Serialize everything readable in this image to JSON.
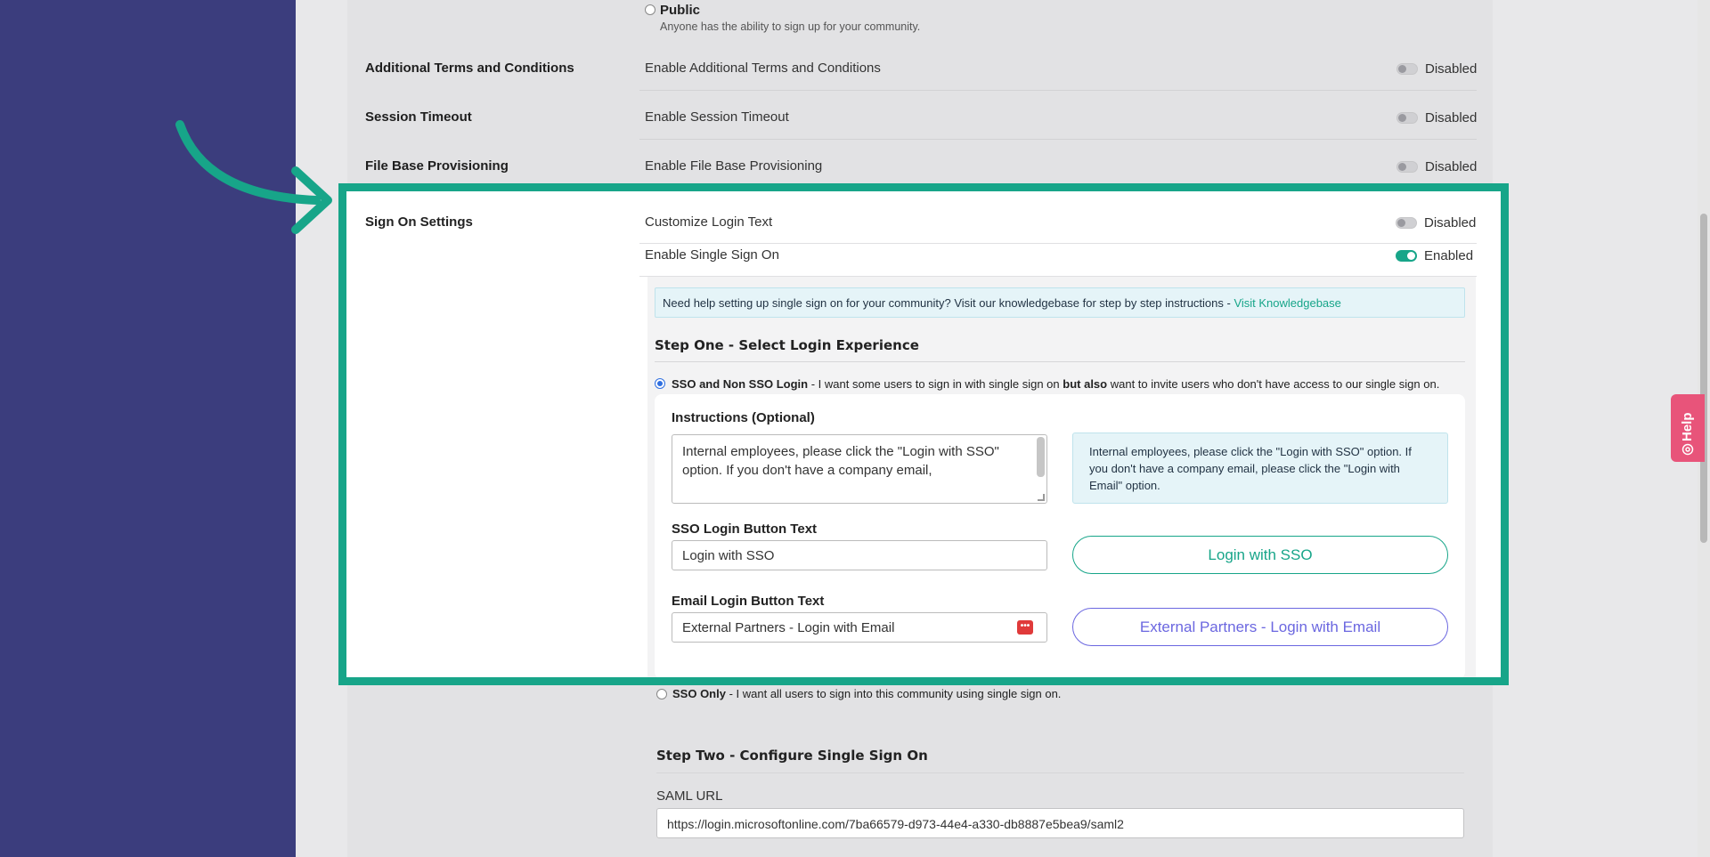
{
  "public_option": {
    "label": "Public",
    "description": "Anyone has the ability to sign up for your community."
  },
  "settings_rows": [
    {
      "label": "Additional Terms and Conditions",
      "description": "Enable Additional Terms and Conditions",
      "state": "Disabled"
    },
    {
      "label": "Session Timeout",
      "description": "Enable Session Timeout",
      "state": "Disabled"
    },
    {
      "label": "File Base Provisioning",
      "description": "Enable File Base Provisioning",
      "state": "Disabled"
    }
  ],
  "sign_on": {
    "label": "Sign On Settings",
    "customize_login": {
      "description": "Customize Login Text",
      "state": "Disabled"
    },
    "single_sign_on": {
      "description": "Enable Single Sign On",
      "state": "Enabled"
    },
    "info_banner": {
      "text": "Need help setting up single sign on for your community? Visit our knowledgebase for step by step instructions - ",
      "link": "Visit Knowledgebase"
    },
    "step_one_title": "Step One - Select Login Experience",
    "option_sso_and_non": {
      "title": "SSO and Non SSO Login",
      "text_before": " - I want some users to sign in with single sign on ",
      "bold": "but also",
      "text_after": " want to invite users who don't have access to our single sign on."
    },
    "instructions": {
      "label": "Instructions (Optional)",
      "value": "Internal employees, please click the \"Login with SSO\" option. If you don't have a company email,",
      "preview": "Internal employees, please click the \"Login with SSO\" option. If you don't have a company email, please click the \"Login with Email\" option."
    },
    "sso_button": {
      "label": "SSO Login Button Text",
      "value": "Login with SSO",
      "preview": "Login with SSO"
    },
    "email_button": {
      "label": "Email Login Button Text",
      "value": "External Partners - Login with Email",
      "preview": "External Partners - Login with Email"
    },
    "option_sso_only": {
      "title": "SSO Only",
      "text": " - I want all users to sign into this community using single sign on."
    },
    "step_two_title": "Step Two - Configure Single Sign On",
    "saml": {
      "label": "SAML URL",
      "value": "https://login.microsoftonline.com/7ba66579-d973-44e4-a330-db8887e5bea9/saml2"
    }
  },
  "help_tab": {
    "label": "Help",
    "icon": "lifebuoy-icon"
  },
  "colors": {
    "sidebar": "#3b3d7d",
    "accent": "#17a589",
    "email_button": "#6b67e0",
    "help_tab": "#e8547a"
  },
  "annotation": {
    "icon": "curved-arrow-icon"
  }
}
